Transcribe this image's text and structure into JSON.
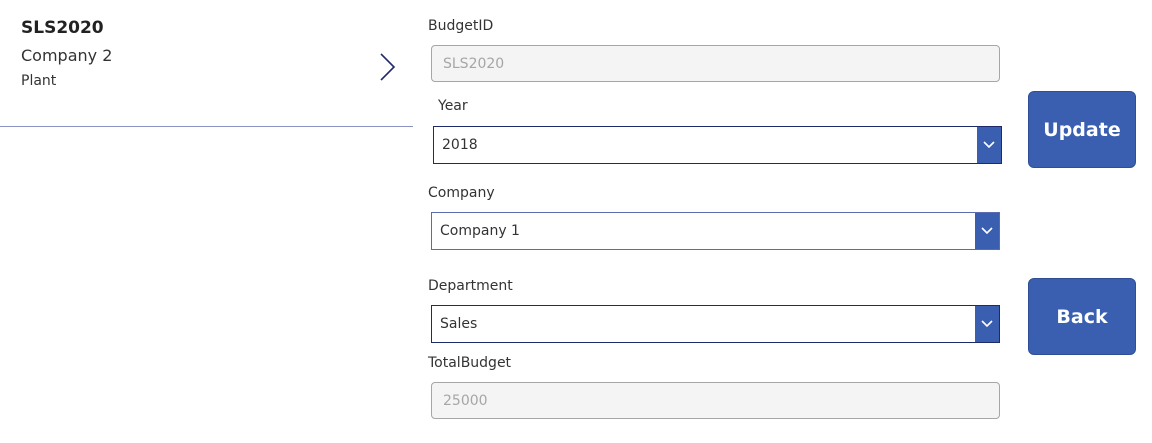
{
  "list_item": {
    "title": "SLS2020",
    "subtitle": "Company 2",
    "body": "Plant"
  },
  "form": {
    "budget_id": {
      "label": "BudgetID",
      "value": "SLS2020"
    },
    "year": {
      "label": "Year",
      "value": "2018"
    },
    "company": {
      "label": "Company",
      "value": "Company 1"
    },
    "department": {
      "label": "Department",
      "value": "Sales"
    },
    "total_budget": {
      "label": "TotalBudget",
      "value": "25000"
    }
  },
  "buttons": {
    "update": "Update",
    "back": "Back"
  }
}
